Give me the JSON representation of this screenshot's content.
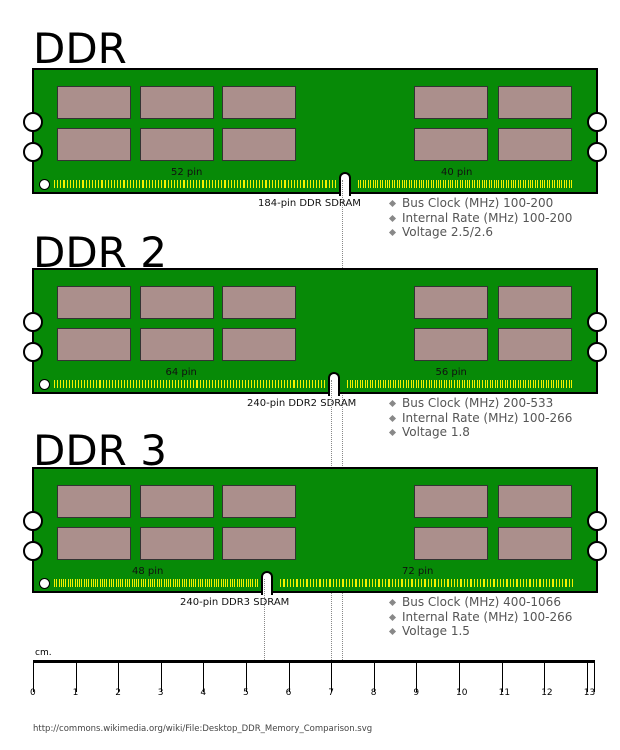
{
  "modules": [
    {
      "title": "DDR",
      "left_pins": "52 pin",
      "right_pins": "40 pin",
      "label": "184-pin DDR SDRAM",
      "specs": [
        "Bus Clock (MHz) 100-200",
        "Internal Rate (MHz) 100-200",
        "Voltage 2.5/2.6"
      ]
    },
    {
      "title": "DDR 2",
      "left_pins": "64 pin",
      "right_pins": "56 pin",
      "label": "240-pin DDR2 SDRAM",
      "specs": [
        "Bus Clock (MHz) 200-533",
        "Internal Rate (MHz) 100-266",
        "Voltage 1.8"
      ]
    },
    {
      "title": "DDR 3",
      "left_pins": "48 pin",
      "right_pins": "72 pin",
      "label": "240-pin DDR3 SDRAM",
      "specs": [
        "Bus Clock (MHz) 400-1066",
        "Internal Rate (MHz) 100-266",
        "Voltage 1.5"
      ]
    }
  ],
  "ruler": {
    "unit": "cm.",
    "ticks": [
      "0",
      "1",
      "2",
      "3",
      "4",
      "5",
      "6",
      "7",
      "8",
      "9",
      "10",
      "11",
      "12",
      "13"
    ]
  },
  "footer": "http://commons.wikimedia.org/wiki/File:Desktop_DDR_Memory_Comparison.svg",
  "colors": {
    "pcb": "#078a07",
    "chip": "#ab8f8c",
    "pins": "#f5f000"
  }
}
